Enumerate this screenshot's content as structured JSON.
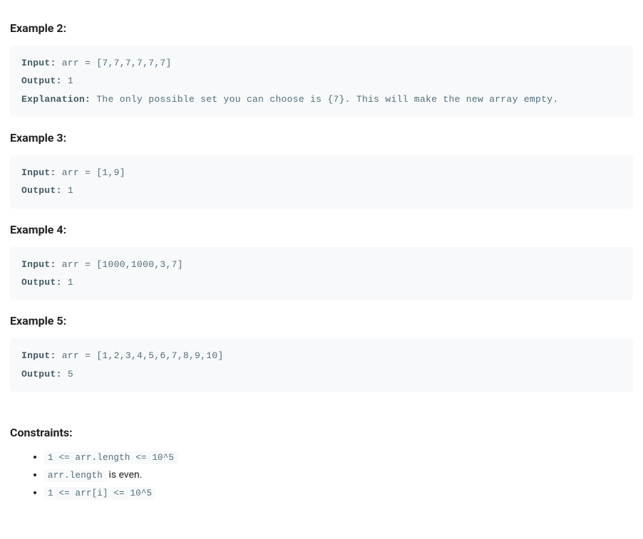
{
  "examples": [
    {
      "heading": "Example 2:",
      "input_label": "Input:",
      "input_value": " arr = [7,7,7,7,7,7]",
      "output_label": "Output:",
      "output_value": " 1",
      "explanation_label": "Explanation:",
      "explanation_value": " The only possible set you can choose is {7}. This will make the new array empty."
    },
    {
      "heading": "Example 3:",
      "input_label": "Input:",
      "input_value": " arr = [1,9]",
      "output_label": "Output:",
      "output_value": " 1"
    },
    {
      "heading": "Example 4:",
      "input_label": "Input:",
      "input_value": " arr = [1000,1000,3,7]",
      "output_label": "Output:",
      "output_value": " 1"
    },
    {
      "heading": "Example 5:",
      "input_label": "Input:",
      "input_value": " arr = [1,2,3,4,5,6,7,8,9,10]",
      "output_label": "Output:",
      "output_value": " 5"
    }
  ],
  "constraints_heading": "Constraints:",
  "constraints": [
    {
      "code": "1 <= arr.length <= 10^5",
      "suffix": ""
    },
    {
      "code": "arr.length",
      "suffix": " is even."
    },
    {
      "code": "1 <= arr[i] <= 10^5",
      "suffix": ""
    }
  ]
}
